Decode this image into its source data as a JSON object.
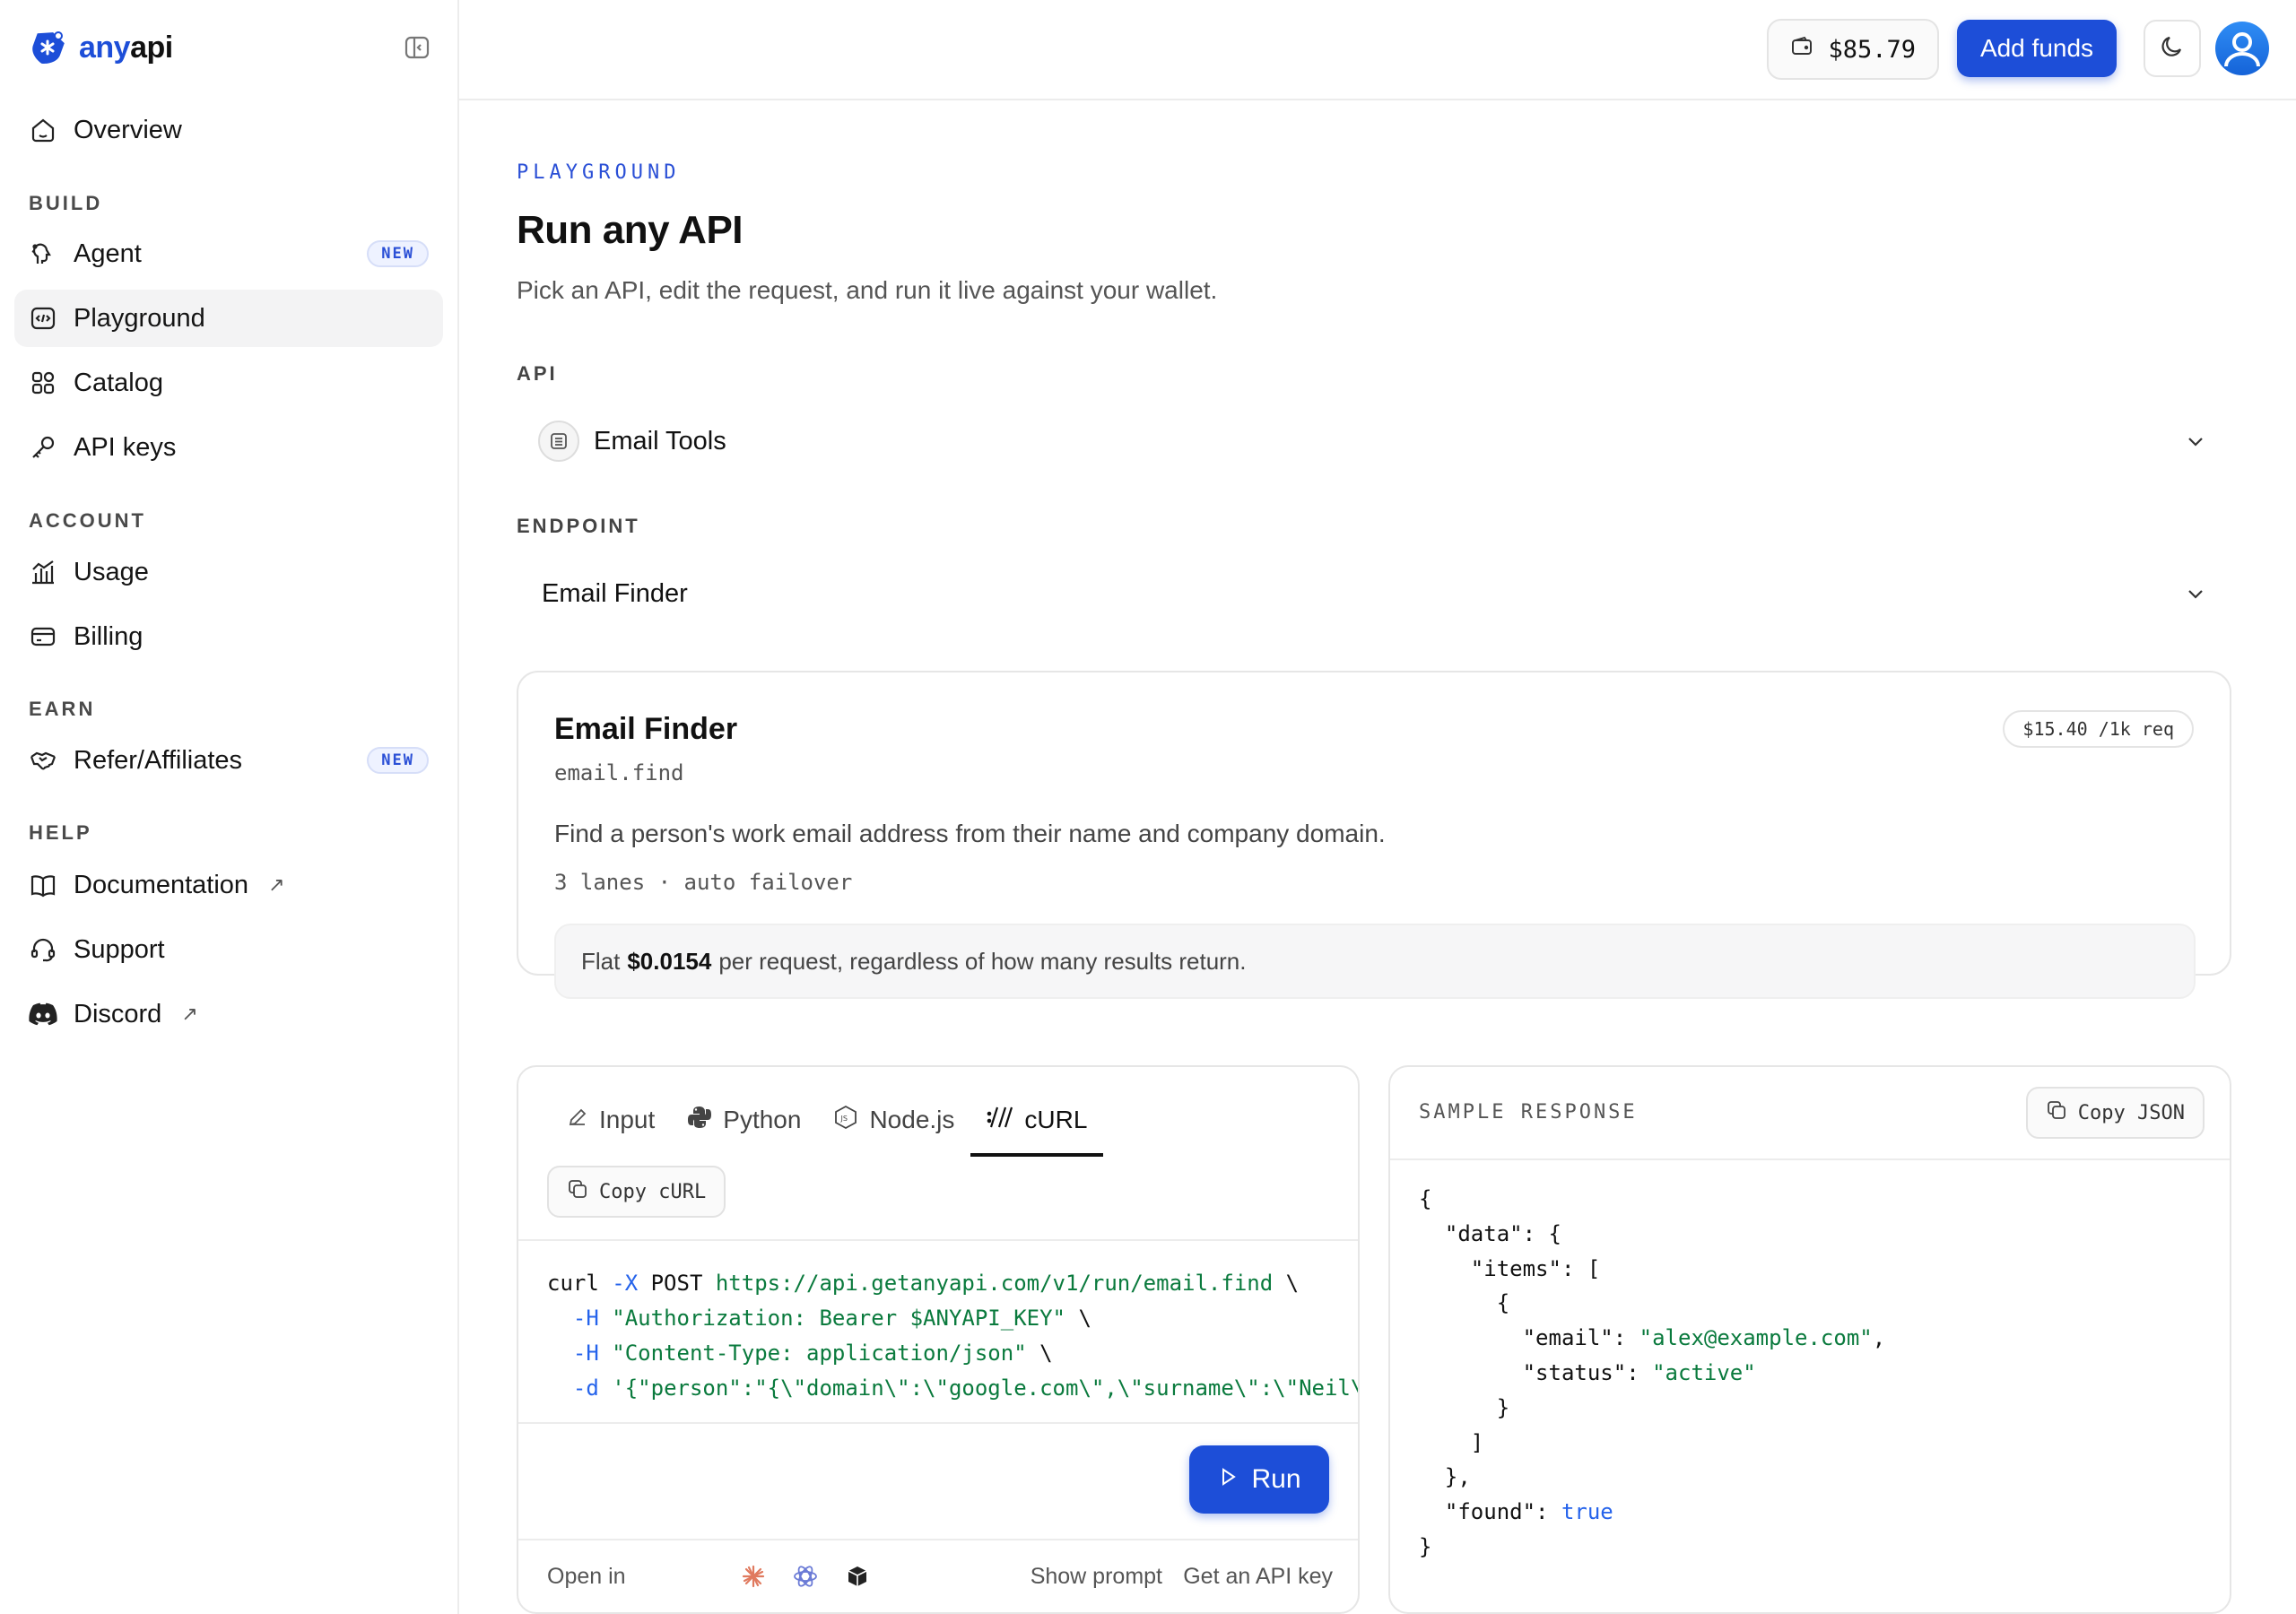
{
  "brand": {
    "name_part1": "any",
    "name_part2": "api"
  },
  "sidebar": {
    "overview": "Overview",
    "sections": {
      "build": "BUILD",
      "account": "ACCOUNT",
      "earn": "EARN",
      "help": "HELP"
    },
    "items": {
      "agent": "Agent",
      "playground": "Playground",
      "catalog": "Catalog",
      "api_keys": "API keys",
      "usage": "Usage",
      "billing": "Billing",
      "refer": "Refer/Affiliates",
      "documentation": "Documentation",
      "support": "Support",
      "discord": "Discord"
    },
    "new_badge": "NEW",
    "external_arrow": "↗",
    "active_item": "playground"
  },
  "topbar": {
    "balance": "$85.79",
    "add_funds": "Add funds"
  },
  "main": {
    "eyebrow": "PLAYGROUND",
    "title": "Run any API",
    "subtitle": "Pick an API, edit the request, and run it live against your wallet.",
    "api_label": "API",
    "api_value": "Email Tools",
    "endpoint_label": "ENDPOINT",
    "endpoint_value": "Email Finder"
  },
  "endpoint_card": {
    "title": "Email Finder",
    "slug": "email.find",
    "price_pill": "$15.40 /1k req",
    "description": "Find a person's work email address from their name and company domain.",
    "lanes": "3 lanes · auto failover",
    "note_prefix": "Flat",
    "note_price": "$0.0154",
    "note_suffix": "per request, regardless of how many results return."
  },
  "code_panel": {
    "tabs": [
      "Input",
      "Python",
      "Node.js",
      "cURL"
    ],
    "active_tab": "cURL",
    "copy_label": "Copy cURL",
    "code": {
      "l1_cmd": "curl ",
      "l1_flag": "-X",
      "l1_method": " POST ",
      "l1_url": "https://api.getanyapi.com/v1/run/email.find",
      "l1_end": " \\",
      "l2_flag": "-H",
      "l2_str": "\"Authorization: Bearer $ANYAPI_KEY\"",
      "l2_end": " \\",
      "l3_flag": "-H",
      "l3_str": "\"Content-Type: application/json\"",
      "l3_end": " \\",
      "l4_flag": "-d",
      "l4_str": "'{\"person\":\"{\\\"domain\\\":\\\"google.com\\\",\\\"surname\\\":\\\"Neil\\\""
    },
    "run_label": "Run",
    "open_in": "Open in",
    "show_prompt": "Show prompt",
    "get_api_key": "Get an API key"
  },
  "response_panel": {
    "title": "SAMPLE RESPONSE",
    "copy_label": "Copy JSON",
    "email": "\"alex@example.com\"",
    "status": "\"active\"",
    "found": "true"
  },
  "colors": {
    "accent": "#1d4ed8",
    "string": "#0a7a3d",
    "flag": "#2563eb"
  }
}
